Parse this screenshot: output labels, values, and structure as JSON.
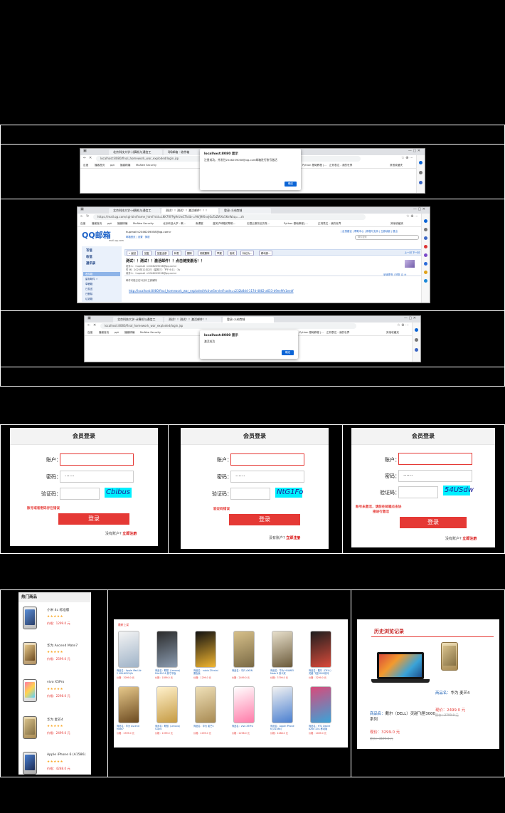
{
  "row1": {
    "shot1": {
      "tabs": [
        "北京科技大学-计算机与通信工",
        "QQ邮箱 - 收件箱",
        "登录 小米商城"
      ],
      "url": "localhost:8080/final_homework_war_exploded/login.jsp",
      "bookmarks": [
        "百度",
        "播客首页",
        "ppt",
        "播客精编",
        "McAfee Security",
        "Python 基础教程 |...",
        "正则表达 - 我的世界",
        "其他收藏夹"
      ],
      "dialog": {
        "title": "localhost:8080 显示",
        "message": "注册成功，并发往2046209058@qq.com邮箱进行账号激活",
        "ok": "确定"
      }
    },
    "shot2": {
      "tabs": [
        "北京科技大学-计算机与通信工",
        "测试！！测试！！激活邮件！！！",
        "登录 小米商城"
      ],
      "url": "https://mail.qq.com/cgi-bin/frame_html?sid=LKK7RFPg9rUwCTk4b-=9kfJ9f6nxJ6uTaZWXs5KeWzq=...zh",
      "bookmarks": [
        "百度",
        "播客首页",
        "ppt",
        "播客精编",
        "McAfee Security",
        "北京科技大学 - 教...",
        "南课堂",
        "蓝英子邮箱的帮助...",
        "无限云服务区仿真...",
        "Python 基础教程 |...",
        "正则表达 - 我的世界",
        "其他收藏夹"
      ],
      "logo_text": "QQ邮箱",
      "logo_sub": "mail.qq.com",
      "user": "hupmail<2046209058@qq.com>",
      "user_links": "邮箱首页 | 设置 · 换肤",
      "top_links": "| 反馈建议 | 帮助中心 | 教程与支持 | 立即续费 | 退出",
      "search_placeholder": "邮件搜索",
      "nav": [
        "写信",
        "收信",
        "通讯录"
      ],
      "folders": [
        "收件箱",
        "星标邮件 ☆",
        "草稿箱",
        "已发送",
        "已删除",
        "垃圾箱"
      ],
      "toolbar": [
        "« 返回",
        "回复",
        "回复全部",
        "转发",
        "删除",
        "彻底删除",
        "举报",
        "拒收",
        "标记为...",
        "移动到..."
      ],
      "pager": "上一封  下一封",
      "mail_subject": "测试！！测试！！激活邮件！！点击链接激活！！",
      "mail_from": "发件人：hupmail <2046209058@qq.com>",
      "mail_time": "时  间：2020年12月2日（星期三）下午 6:11 · 3s",
      "mail_to": "收件人：hupmail <2046209058@qq.com>",
      "mail_safe": "邮件可能已在5分钟   立即解除",
      "mail_link": "http://localhost:8080/final_homework_war_exploded/ActiveServlet?code=c232b8d4-117d-4862-a653-d9ee9fe1eedf",
      "reply_link": "阅读更多 | 回复 ☺ ✉"
    },
    "shot3": {
      "tabs": [
        "北京科技大学-计算机与通信工",
        "测试！！测试！！激活邮件！！",
        "登录 小米商城"
      ],
      "url": "localhost:8080/final_homework_war_exploded/login.jsp",
      "bookmarks": [
        "百度",
        "播客首页",
        "ppt",
        "播客精编",
        "McAfee Security",
        "Python 基础教程 |...",
        "正则表达 - 我的世界",
        "其他收藏夹"
      ],
      "dialog": {
        "title": "localhost:8080 显示",
        "message": "激活成功",
        "ok": "确定"
      }
    }
  },
  "logins": [
    {
      "title": "会员登录",
      "account_label": "账户：",
      "password_label": "密码：",
      "captcha_label": "验证码：",
      "password_value": "······",
      "captcha": "Cbibus",
      "error": "账号或者密码存在错误",
      "login_button": "登录",
      "register_prompt": "没有账户?",
      "register_link": "立即注册"
    },
    {
      "title": "会员登录",
      "account_label": "账户：",
      "password_label": "密码：",
      "captcha_label": "验证码：",
      "password_value": "······",
      "captcha": "NtG1Fo",
      "error": "验证码错误",
      "login_button": "登录",
      "register_prompt": "没有账户?",
      "register_link": "立即注册"
    },
    {
      "title": "会员登录",
      "account_label": "账户：",
      "password_label": "密码：",
      "captcha_label": "验证码：",
      "password_value": "······",
      "captcha": "54USdw",
      "error_line1": "账号未激活，请前往邮箱点击协",
      "error_line2": "接进行激活",
      "login_button": "登录",
      "register_prompt": "没有账户?",
      "register_link": "立即注册"
    }
  ],
  "hot": {
    "title": "热门商品",
    "items": [
      {
        "name": "小米 4c 标准版",
        "stars": "★★★★★",
        "price": "价格：1299.0 元"
      },
      {
        "name": "华为 Ascend Mate7",
        "stars": "★★★★★",
        "price": "价格：2599.0 元"
      },
      {
        "name": "vivo X5Pro",
        "stars": "★★★★★",
        "price": "价格：2298.0 元"
      },
      {
        "name": "华为 麦芒4",
        "stars": "★★★★★",
        "price": "价格：2499.0 元"
      },
      {
        "name": "Apple iPhone 6 (A1586)",
        "stars": "★★★★★",
        "price": "价格：4288.0 元"
      }
    ]
  },
  "grid": {
    "tag": "最新上架",
    "row1": [
      {
        "name": "商品名：Apple iPad Air 2 MGLW2CH/A",
        "price": "价格：3099.0 元"
      },
      {
        "name": "商品名：联想（Lenovo）Miix300 8 英寸平板",
        "price": "价格：1899.0 元"
      },
      {
        "name": "商品名：nubia Z9 mini 黑色版",
        "price": "价格：1299.0 元"
      },
      {
        "name": "商品名：中兴 AXON",
        "price": "价格：2499.0 元"
      },
      {
        "name": "商品名：华为 HUAWEI Mate 8 双卡双",
        "price": "价格：3799.0 元"
      },
      {
        "name": "商品名：戴尔（DELL）灵越 飞匣3000系列",
        "price": "价格：3299.0 元"
      }
    ],
    "row2": [
      {
        "name": "商品名：华为 Ascend Mate7",
        "price": "价格：2599.0 元"
      },
      {
        "name": "商品名：联想（Lenovo）S1pro",
        "price": "价格：1099.0 元"
      },
      {
        "name": "商品名：华为 麦芒4",
        "price": "价格：2499.0 元"
      },
      {
        "name": "商品名：vivo X5Pro",
        "price": "价格：2298.0 元"
      },
      {
        "name": "商品名：Apple iPhone 6 (A1586)",
        "price": "价格：4288.0 元"
      },
      {
        "name": "商品名：HTC Desire 826d 32G 移动版",
        "price": "价格：1469.0 元"
      }
    ]
  },
  "history": {
    "title": "历史浏览记录",
    "laptop_name_label": "商品名：",
    "laptop_name": "戴尔（DELL）灵越飞匣3000系列",
    "laptop_price": "现价：3299.0 元",
    "laptop_old": "原价：3599.0 元",
    "phone_name_label": "商品名：",
    "phone_name": "华为 麦芒4",
    "phone_price": "现价：2499.0 元",
    "phone_old": "原价：2799.0 元"
  },
  "colors": {
    "accent_red": "#e53935",
    "captcha_bg": "#00f0ff",
    "link_blue": "#1a5fb4",
    "dialog_button": "#0a64d6"
  }
}
